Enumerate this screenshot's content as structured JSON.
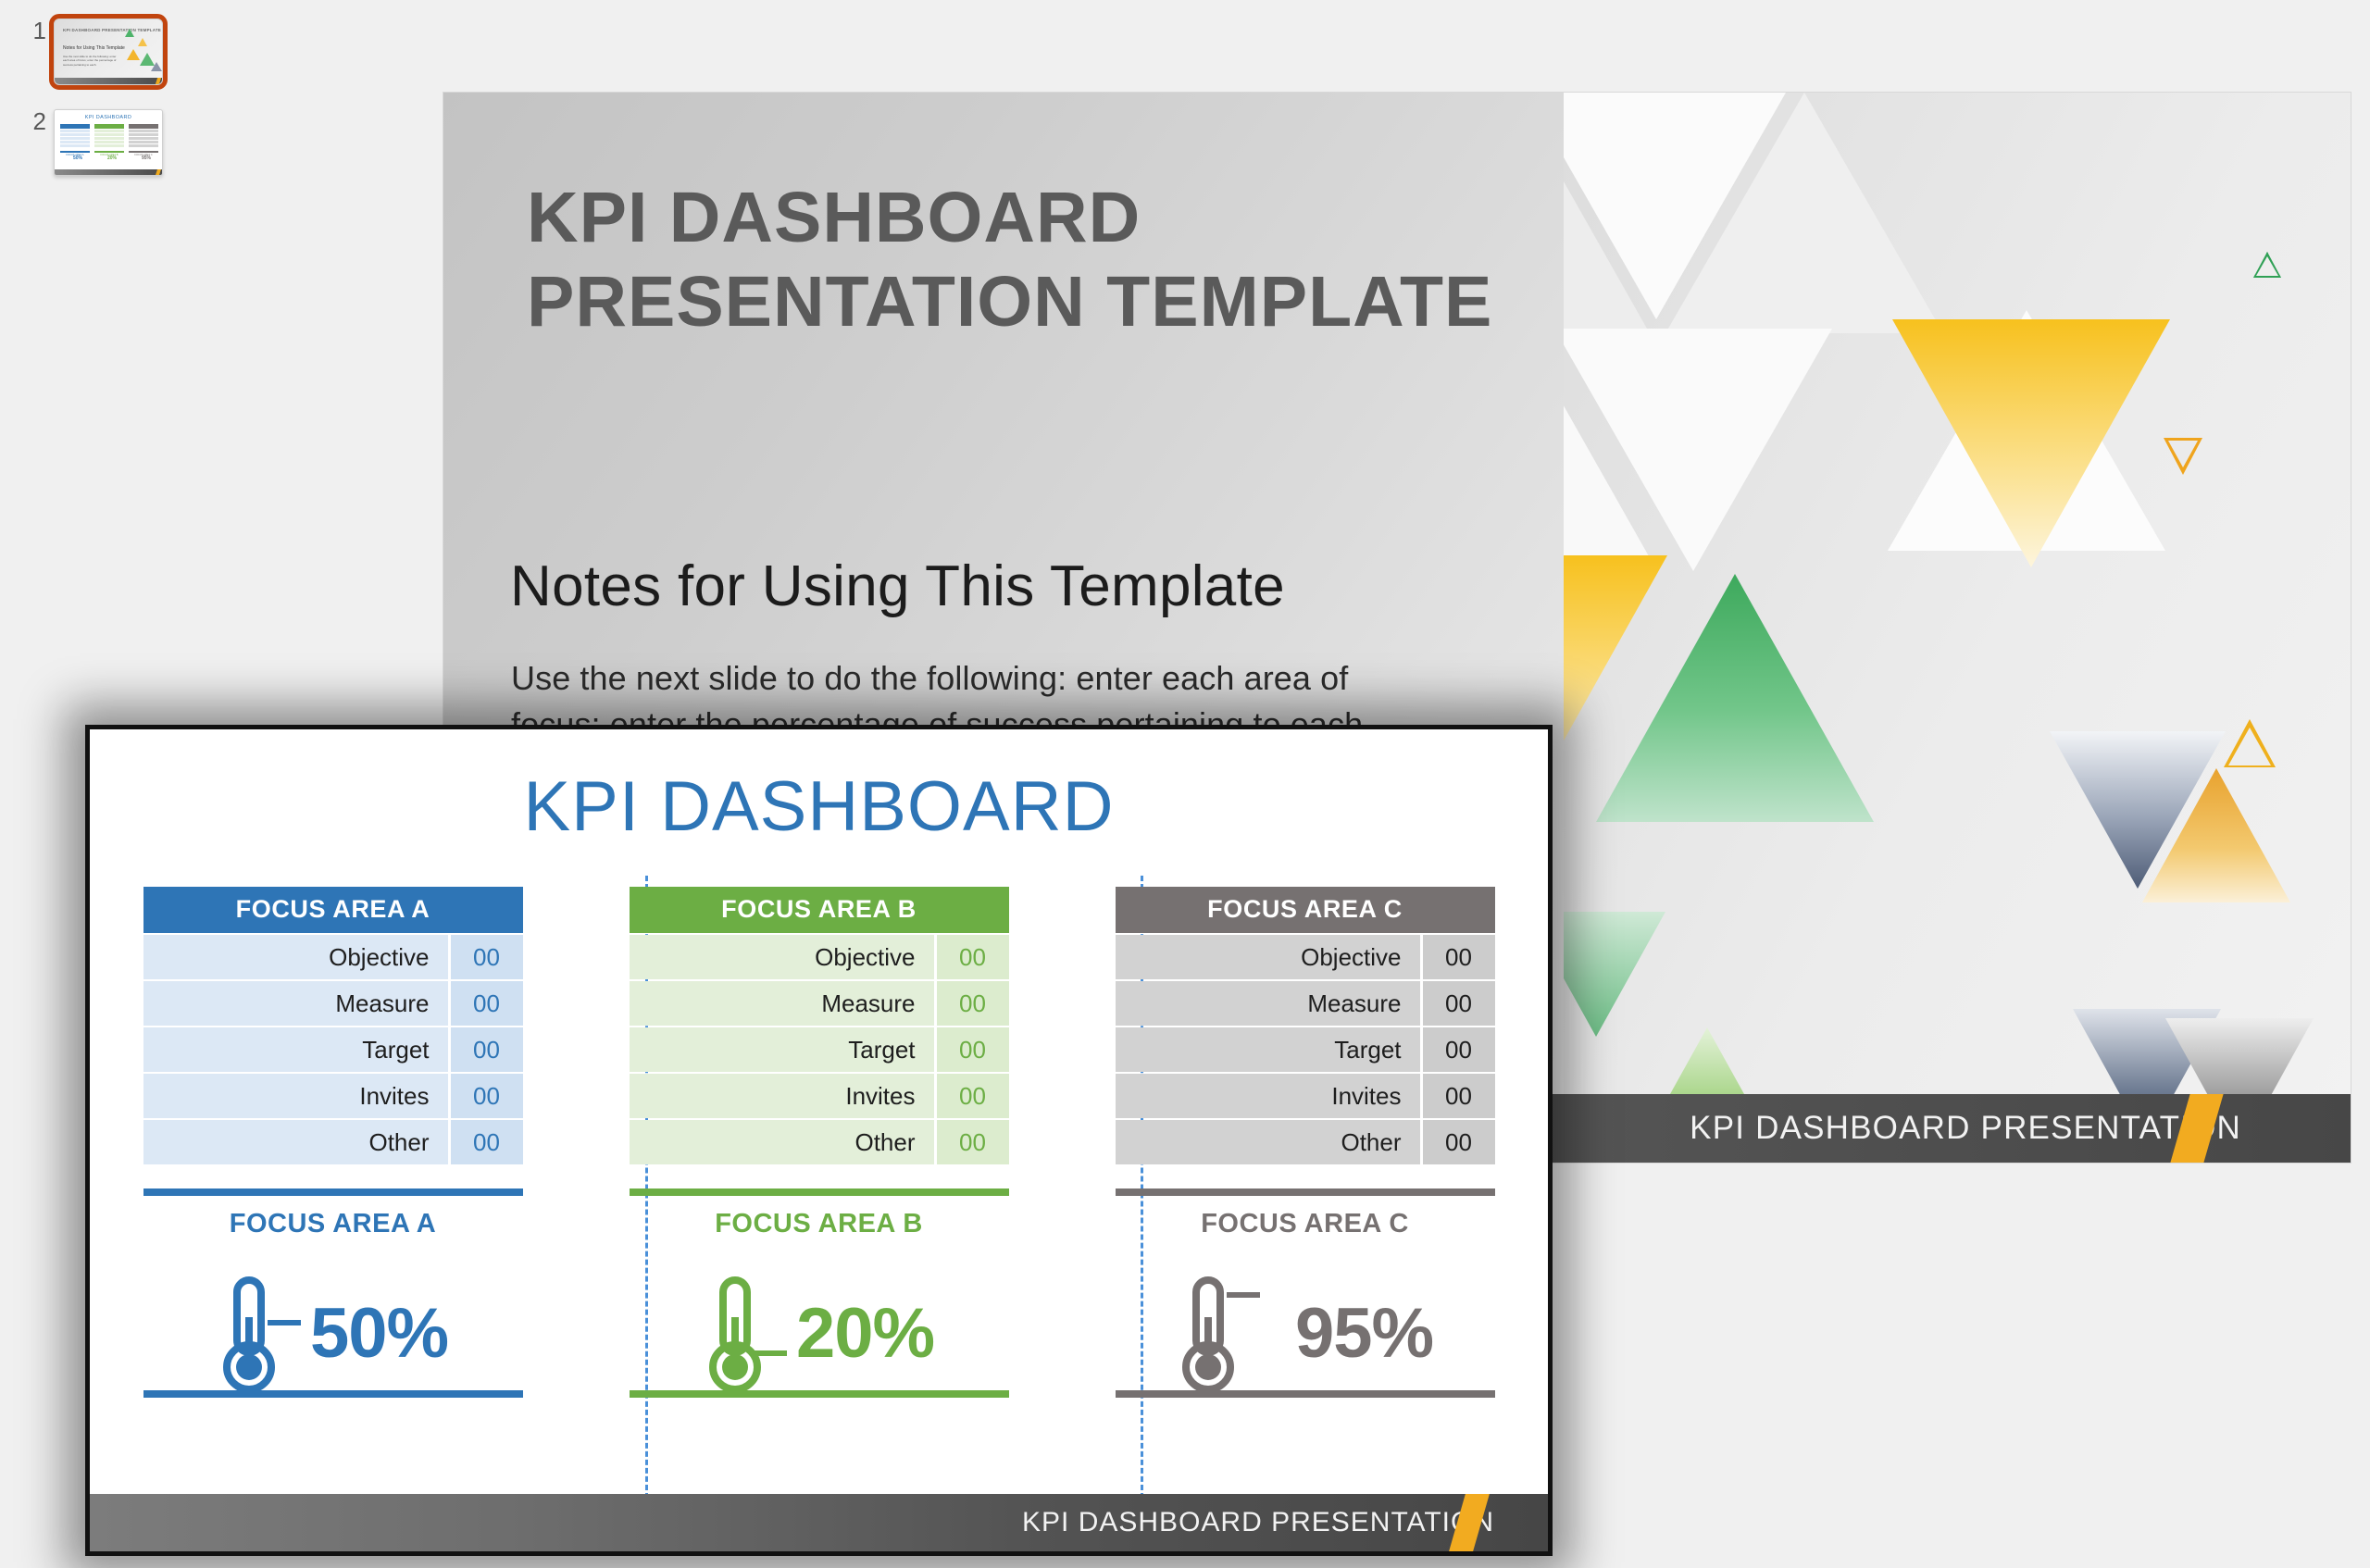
{
  "app": {
    "background_color": "#f0f0f0"
  },
  "thumbnail_rail": {
    "slides": [
      {
        "number": "1",
        "selected": true,
        "title": "KPI DASHBOARD PRESENTATION TEMPLATE",
        "heading": "Notes for Using This Template",
        "body": "Use the next slide to do the following: enter each area of focus; enter the percentage of success pertaining to each.",
        "footer": "KPI DASHBOARD PRESENTATION"
      },
      {
        "number": "2",
        "selected": false,
        "title": "KPI DASHBOARD",
        "footer": "KPI DASHBOARD PRESENTATION"
      }
    ]
  },
  "slide1": {
    "title": "KPI DASHBOARD PRESENTATION TEMPLATE",
    "heading": "Notes for Using This Template",
    "body": "Use the next slide to do the following: enter each area of focus; enter the percentage of success pertaining to each",
    "footer": "KPI DASHBOARD PRESENTATION",
    "accent_color": "#f2ab20",
    "title_color": "#5a5a5a"
  },
  "popup_slide": {
    "title": "KPI DASHBOARD",
    "title_color": "#2e75b6",
    "footer": "KPI DASHBOARD PRESENTATION",
    "accent_color": "#f2ab20",
    "row_labels": [
      "Objective",
      "Measure",
      "Target",
      "Invites",
      "Other"
    ],
    "columns": [
      {
        "header": "FOCUS AREA A",
        "header_bg": "#2e75b6",
        "row_bg": "#dce8f5",
        "value_bg": "#cfe0f2",
        "accent": "#2e75b6",
        "values": [
          "00",
          "00",
          "00",
          "00",
          "00"
        ],
        "area_label": "FOCUS AREA A",
        "percent": "50%",
        "percent_number": 50
      },
      {
        "header": "FOCUS AREA B",
        "header_bg": "#6cae44",
        "row_bg": "#e3efd9",
        "value_bg": "#dcecce",
        "accent": "#6cae44",
        "values": [
          "00",
          "00",
          "00",
          "00",
          "00"
        ],
        "area_label": "FOCUS AREA B",
        "percent": "20%",
        "percent_number": 20
      },
      {
        "header": "FOCUS AREA C",
        "header_bg": "#767171",
        "row_bg": "#d2d2d2",
        "value_bg": "#cccccc",
        "accent": "#767171",
        "values": [
          "00",
          "00",
          "00",
          "00",
          "00"
        ],
        "area_label": "FOCUS AREA C",
        "percent": "95%",
        "percent_number": 95
      }
    ]
  },
  "decor": {
    "triangle_colors": {
      "green": "#3aa85a",
      "amber": "#f0ab1e",
      "slate": "#55627a",
      "light": "#ffffff"
    }
  }
}
